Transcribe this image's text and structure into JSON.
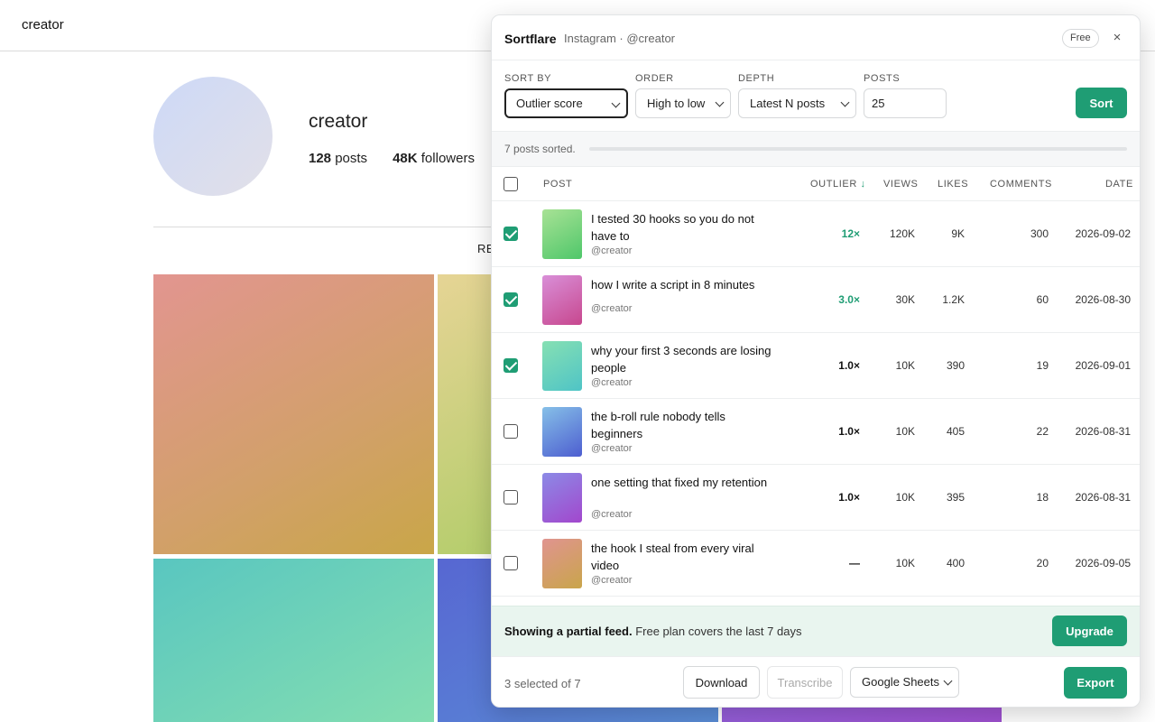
{
  "instagram": {
    "top_username": "creator",
    "profile": {
      "name": "creator",
      "posts_count": "128",
      "posts_label": "posts",
      "followers_count": "48K",
      "followers_label": "followers"
    },
    "tab_label": "RE"
  },
  "panel": {
    "brand": "Sortflare",
    "context": "Instagram · @creator",
    "plan_badge": "Free",
    "close_glyph": "×",
    "controls": {
      "sort_by_label": "SORT BY",
      "sort_by_value": "Outlier score",
      "order_label": "ORDER",
      "order_value": "High to low",
      "depth_label": "DEPTH",
      "depth_value": "Latest N posts",
      "posts_label": "POSTS",
      "posts_value": "25",
      "sort_button": "Sort"
    },
    "status_text": "7 posts sorted.",
    "table": {
      "headers": {
        "post": "POST",
        "outlier": "OUTLIER",
        "outlier_arrow": "↓",
        "views": "VIEWS",
        "likes": "LIKES",
        "comments": "COMMENTS",
        "date": "DATE"
      },
      "rows": [
        {
          "checked": true,
          "title": "I tested 30 hooks so you do not have to",
          "handle": "@creator",
          "outlier": "12×",
          "views": "120K",
          "likes": "9K",
          "comments": "300",
          "date": "2026-09-02",
          "highlight": true,
          "thumb_from": "#a8e295",
          "thumb_to": "#4fc76a"
        },
        {
          "checked": true,
          "title": "how I write a script in 8 minutes",
          "handle": "@creator",
          "outlier": "3.0×",
          "views": "30K",
          "likes": "1.2K",
          "comments": "60",
          "date": "2026-08-30",
          "highlight": true,
          "thumb_from": "#d98fd8",
          "thumb_to": "#c7478e"
        },
        {
          "checked": true,
          "title": "why your first 3 seconds are losing people",
          "handle": "@creator",
          "outlier": "1.0×",
          "views": "10K",
          "likes": "390",
          "comments": "19",
          "date": "2026-09-01",
          "highlight": false,
          "thumb_from": "#86e0b3",
          "thumb_to": "#4fc4c6"
        },
        {
          "checked": false,
          "title": "the b-roll rule nobody tells beginners",
          "handle": "@creator",
          "outlier": "1.0×",
          "views": "10K",
          "likes": "405",
          "comments": "22",
          "date": "2026-08-31",
          "highlight": false,
          "thumb_from": "#86c0e8",
          "thumb_to": "#4d5ed0"
        },
        {
          "checked": false,
          "title": "one setting that fixed my retention",
          "handle": "@creator",
          "outlier": "1.0×",
          "views": "10K",
          "likes": "395",
          "comments": "18",
          "date": "2026-08-31",
          "highlight": false,
          "thumb_from": "#8c8ae6",
          "thumb_to": "#a247cd"
        },
        {
          "checked": false,
          "title": "the hook I steal from every viral video",
          "handle": "@creator",
          "outlier": "—",
          "views": "10K",
          "likes": "400",
          "comments": "20",
          "date": "2026-09-05",
          "highlight": false,
          "thumb_from": "#e09490",
          "thumb_to": "#c9a54a"
        }
      ]
    },
    "notice": {
      "strong": "Showing a partial feed.",
      "text": " Free plan covers the last 7 days",
      "button": "Upgrade"
    },
    "footer": {
      "selection": "3 selected of 7",
      "download": "Download",
      "transcribe": "Transcribe",
      "destination": "Google Sheets",
      "export": "Export"
    }
  }
}
